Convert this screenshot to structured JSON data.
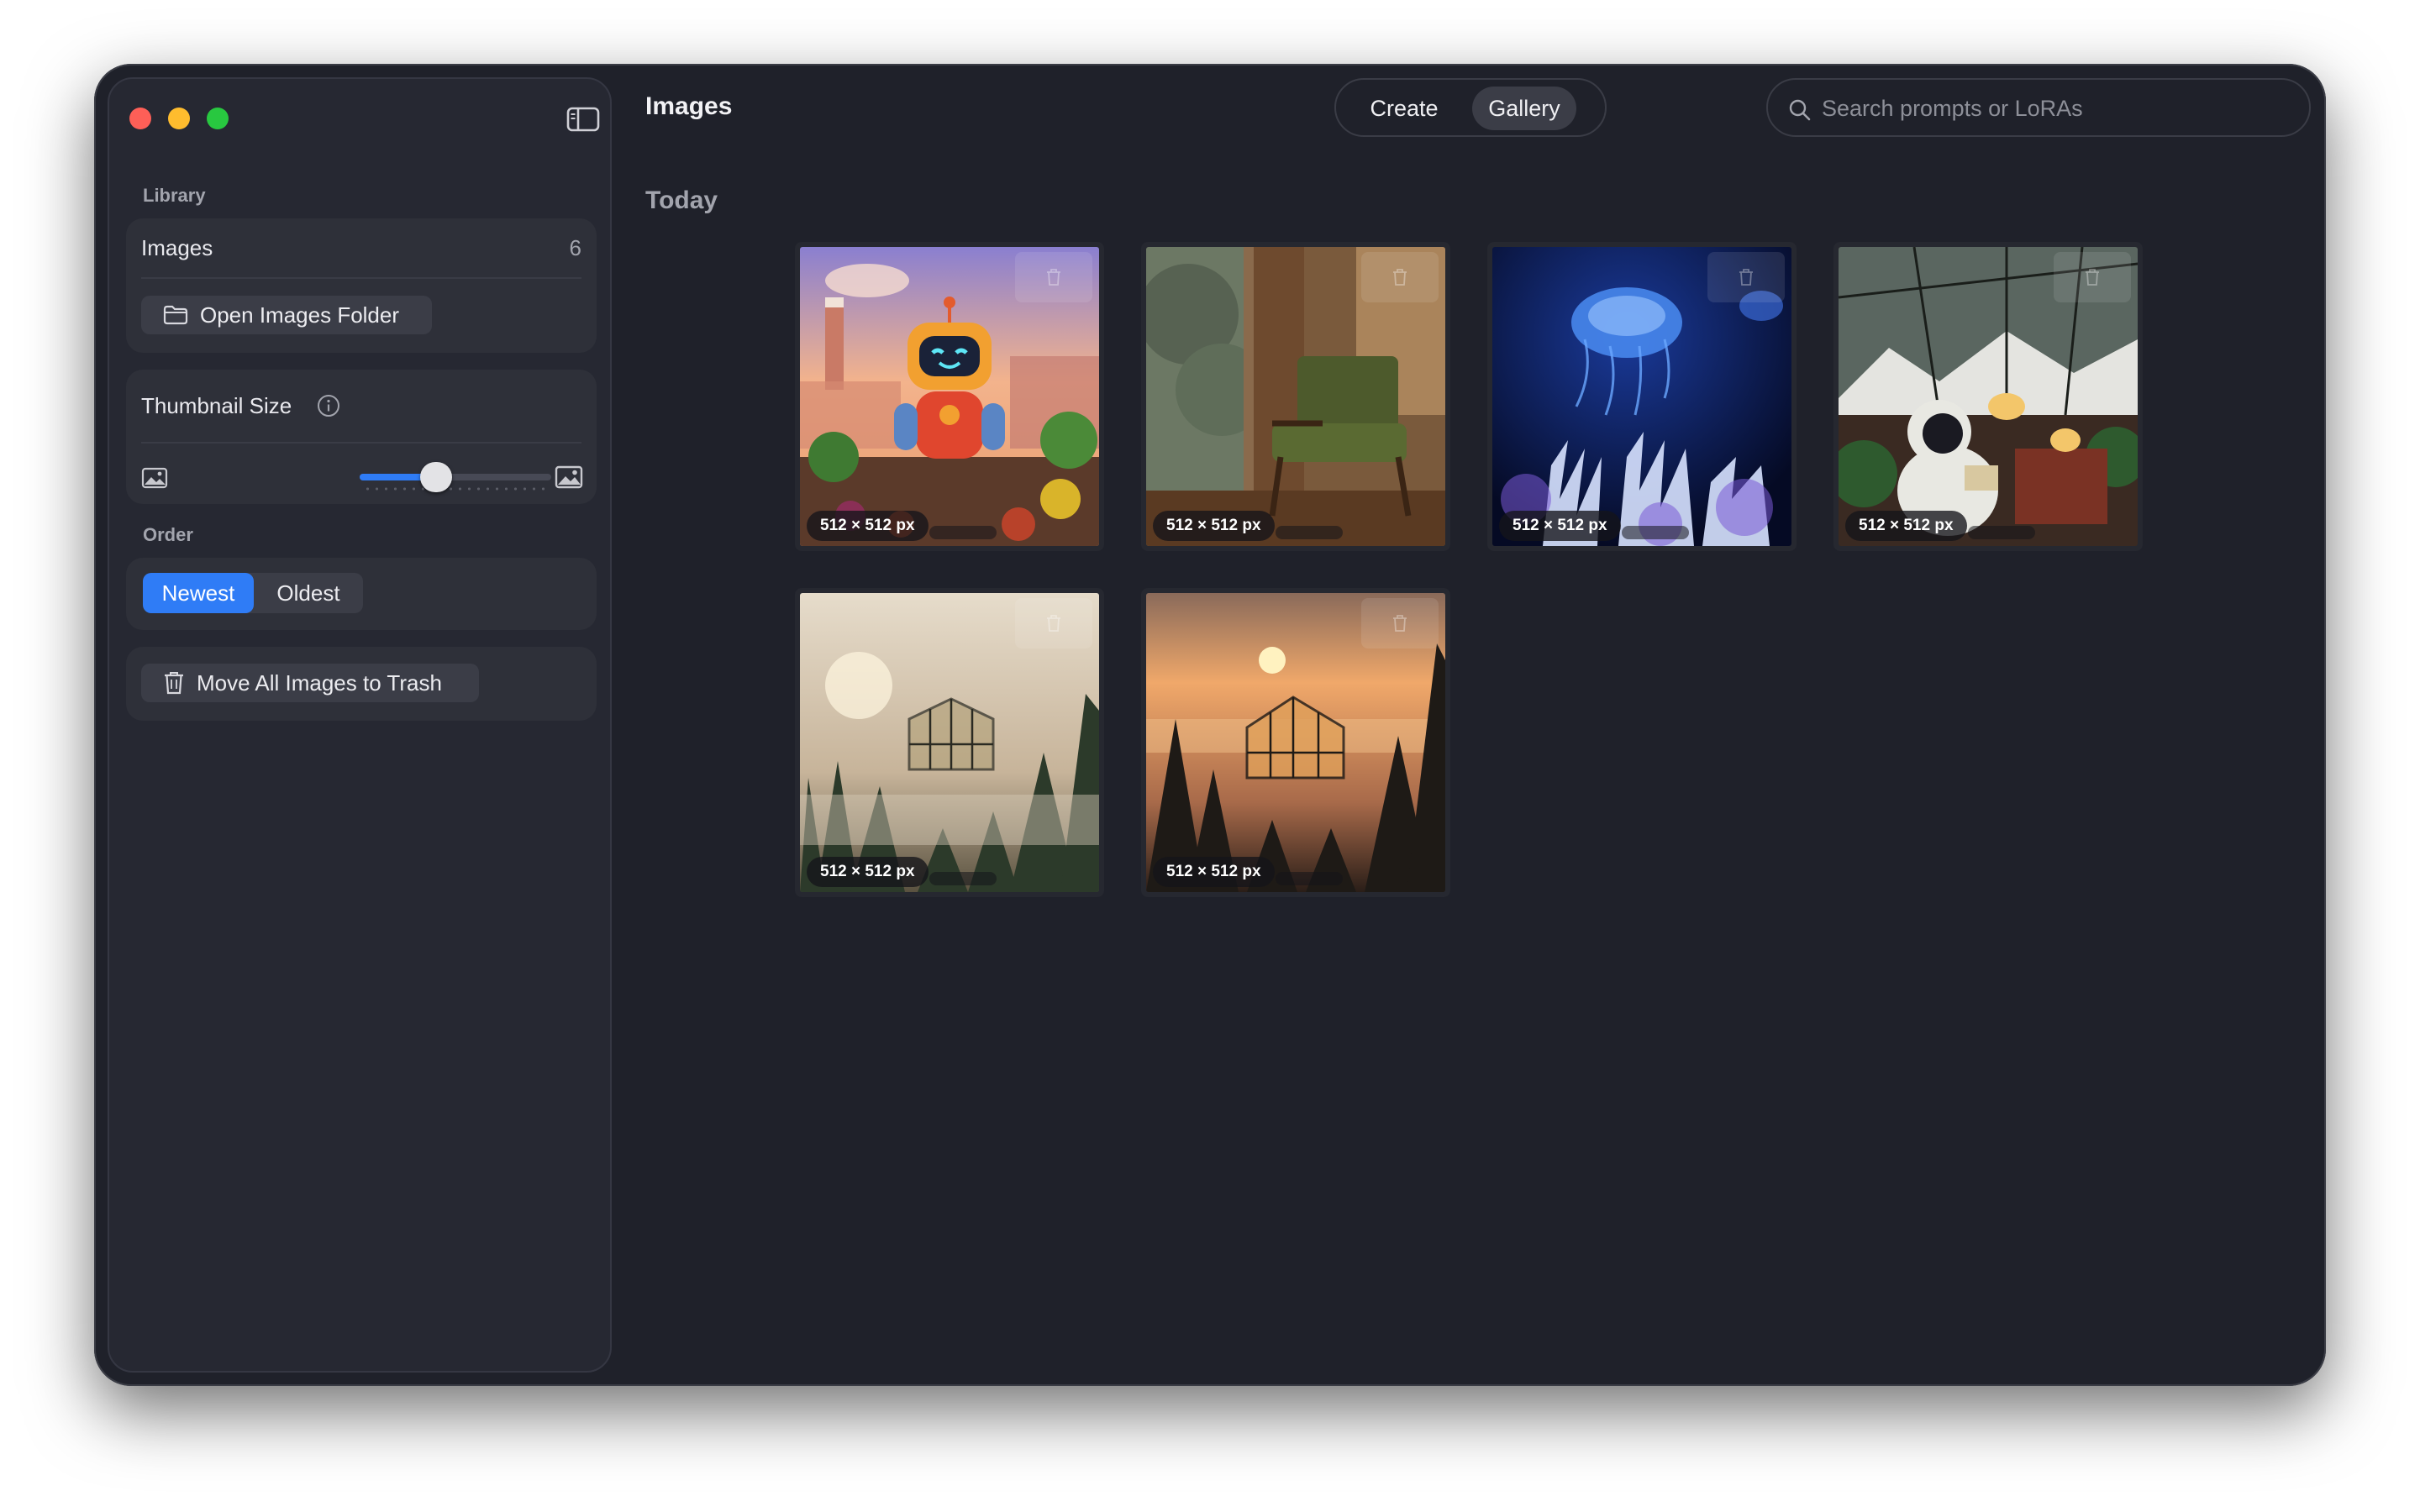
{
  "window": {
    "title": "Images"
  },
  "sidebar": {
    "library_label": "Library",
    "images_row": {
      "label": "Images",
      "count": "6"
    },
    "open_folder_label": "Open Images Folder",
    "thumbnail_size": {
      "label": "Thumbnail Size",
      "level": 0.4
    },
    "order_label": "Order",
    "order_options": [
      "Newest",
      "Oldest"
    ],
    "order_selected": "Newest",
    "trash_all_label": "Move All Images to Trash"
  },
  "toolbar": {
    "modes": [
      "Create",
      "Gallery"
    ],
    "active_mode": "Gallery",
    "search_placeholder": "Search prompts or LoRAs"
  },
  "gallery": {
    "section": "Today",
    "images": [
      {
        "size": "512 × 512 px",
        "subject": "robot-garden"
      },
      {
        "size": "512 × 512 px",
        "subject": "armchair-window"
      },
      {
        "size": "512 × 512 px",
        "subject": "jellyfish-coral"
      },
      {
        "size": "512 × 512 px",
        "subject": "astronaut-greenhouse"
      },
      {
        "size": "512 × 512 px",
        "subject": "greenhouse-forest-fog"
      },
      {
        "size": "512 × 512 px",
        "subject": "greenhouse-forest-sunset"
      }
    ]
  },
  "colors": {
    "accent": "#2f7cf6",
    "window_bg": "#1f212a",
    "sidebar_bg": "#262832"
  }
}
